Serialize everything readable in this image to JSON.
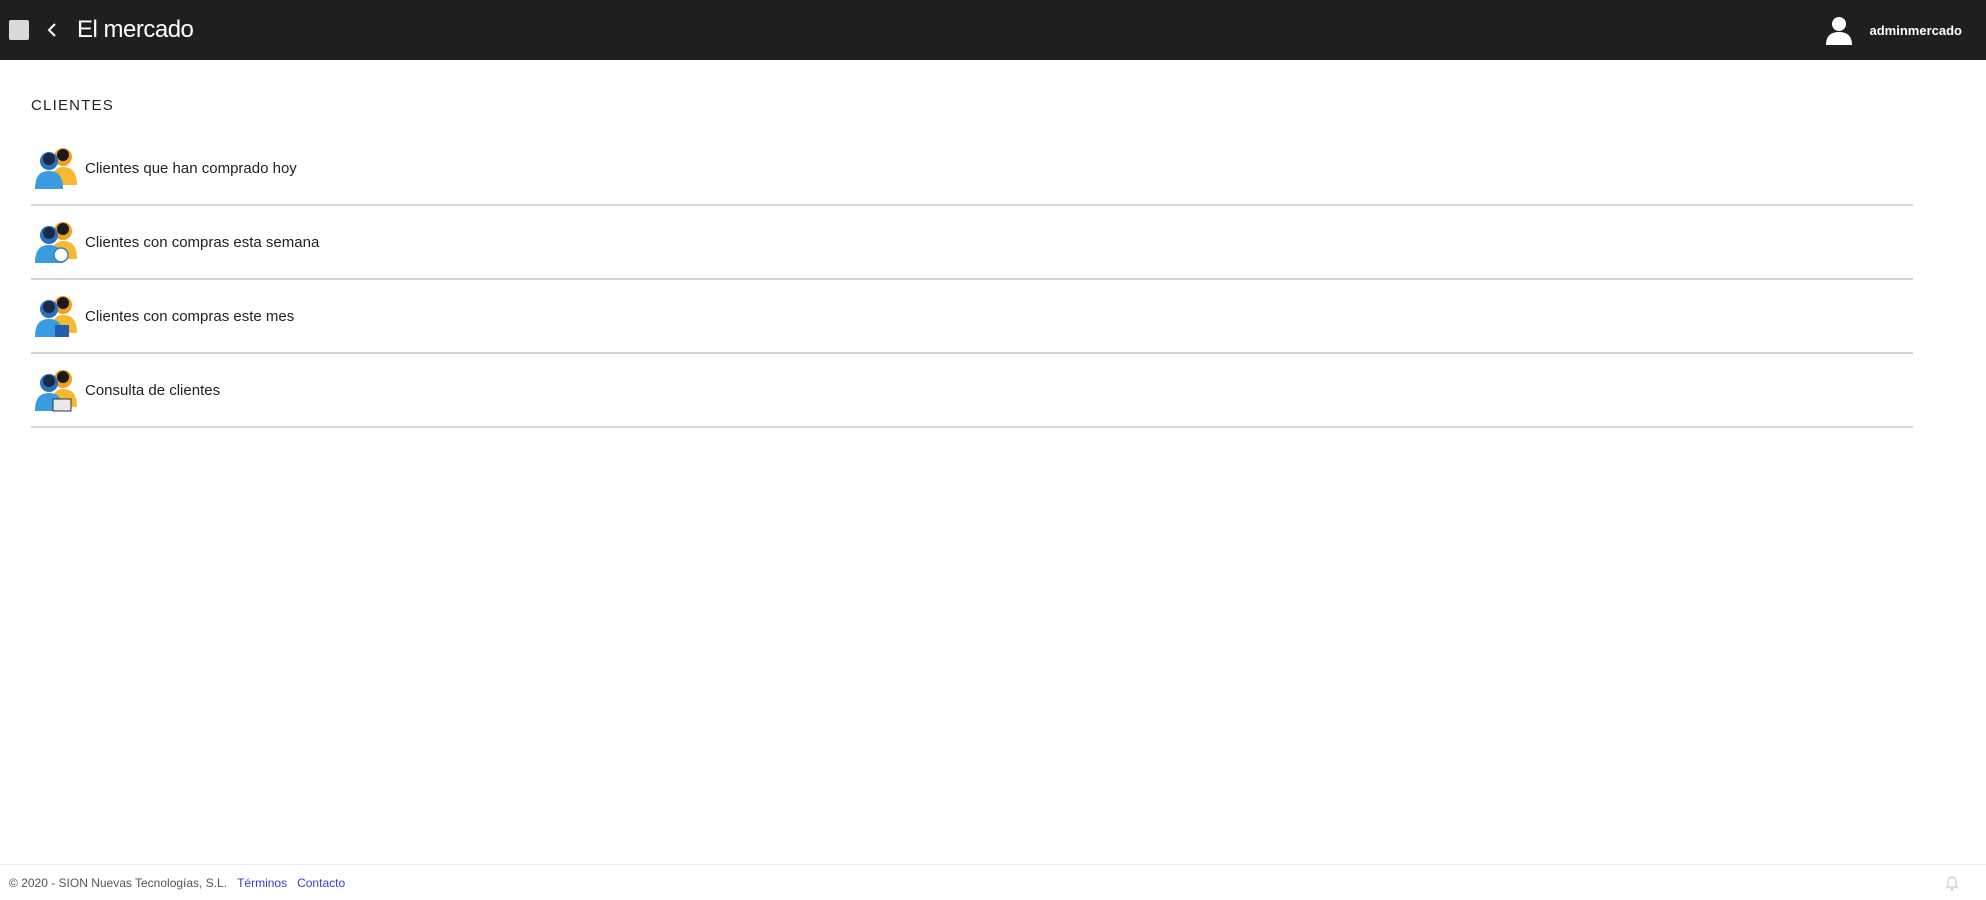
{
  "header": {
    "title": "El mercado",
    "username": "adminmercado"
  },
  "icons": {
    "menu": "menu-square-icon",
    "back": "chevron-left-icon",
    "user": "user-icon",
    "clients": "users-group-icon",
    "notification": "bell-icon"
  },
  "colors": {
    "topbar": "#1f1f1f",
    "link": "#3b3bd6",
    "divider": "#d6d6d6"
  },
  "section": {
    "title": "CLIENTES",
    "items": [
      {
        "label": "Clientes que han comprado hoy"
      },
      {
        "label": "Clientes con compras esta semana"
      },
      {
        "label": "Clientes con compras este mes"
      },
      {
        "label": "Consulta de clientes"
      }
    ]
  },
  "footer": {
    "copyright": "© 2020 - SION Nuevas Tecnologías, S.L.",
    "links": [
      "Términos",
      "Contacto"
    ]
  }
}
